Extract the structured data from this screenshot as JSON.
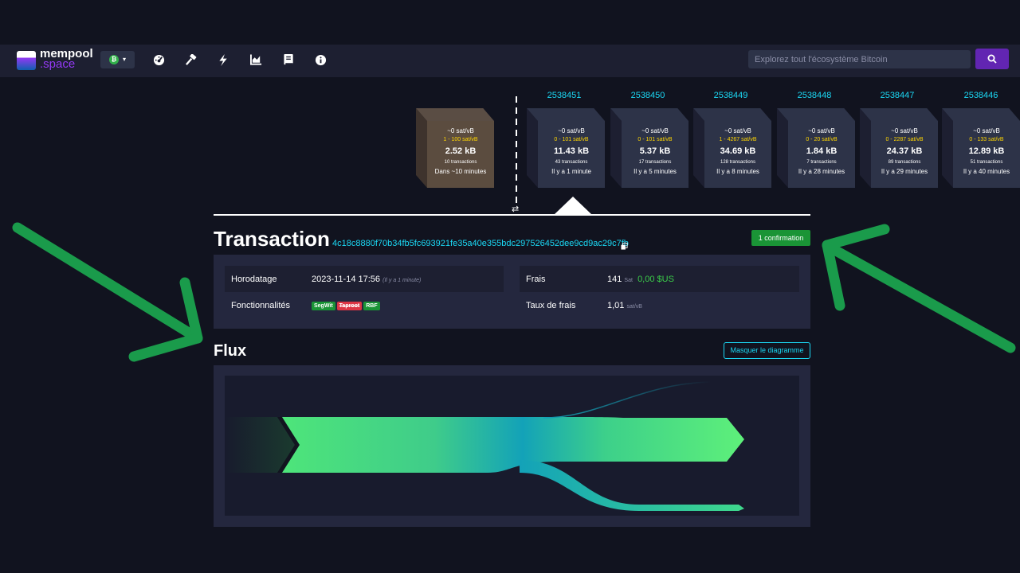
{
  "nav": {
    "logo_top": "mempool",
    "logo_bottom": ".space",
    "network_symbol": "₿",
    "search_placeholder": "Explorez tout l'écosystème Bitcoin",
    "icons": [
      "dashboard-icon",
      "hammer-icon",
      "lightning-icon",
      "chart-icon",
      "book-icon",
      "info-icon"
    ]
  },
  "pending_block": {
    "fee": "~0 sat/vB",
    "range": "1 - 100 sat/vB",
    "size": "2.52 kB",
    "txs": "10 transactions",
    "time": "Dans ~10 minutes"
  },
  "blocks": [
    {
      "height": "2538451",
      "fee": "~0 sat/vB",
      "range": "0 - 101 sat/vB",
      "size": "11.43 kB",
      "txs": "43 transactions",
      "time": "Il y a 1 minute"
    },
    {
      "height": "2538450",
      "fee": "~0 sat/vB",
      "range": "0 - 101 sat/vB",
      "size": "5.37 kB",
      "txs": "17 transactions",
      "time": "Il y a 5 minutes"
    },
    {
      "height": "2538449",
      "fee": "~0 sat/vB",
      "range": "1 - 4267 sat/vB",
      "size": "34.69 kB",
      "txs": "128 transactions",
      "time": "Il y a 8 minutes"
    },
    {
      "height": "2538448",
      "fee": "~0 sat/vB",
      "range": "0 - 20 sat/vB",
      "size": "1.84 kB",
      "txs": "7 transactions",
      "time": "Il y a 28 minutes"
    },
    {
      "height": "2538447",
      "fee": "~0 sat/vB",
      "range": "0 - 2287 sat/vB",
      "size": "24.37 kB",
      "txs": "89 transactions",
      "time": "Il y a 29 minutes"
    },
    {
      "height": "2538446",
      "fee": "~0 sat/vB",
      "range": "0 - 133 sat/vB",
      "size": "12.89 kB",
      "txs": "51 transactions",
      "time": "Il y a 40 minutes"
    }
  ],
  "swap_symbol": "⇄",
  "transaction": {
    "title": "Transaction",
    "txid": "4c18c8880f70b34fb5fc693921fe35a40e355bdc297526452dee9cd9ac29c7fb",
    "confirmations": "1 confirmation",
    "timestamp_label": "Horodatage",
    "timestamp_value": "2023-11-14 17:56",
    "timestamp_relative": "(Il y a 1 minute)",
    "features_label": "Fonctionnalités",
    "features": [
      "SegWit",
      "Taproot",
      "RBF"
    ],
    "fee_label": "Frais",
    "fee_value": "141",
    "fee_unit": "Sat",
    "fee_usd": "0,00 $US",
    "rate_label": "Taux de frais",
    "rate_value": "1,01",
    "rate_unit": "sat/vB"
  },
  "flux": {
    "title": "Flux",
    "hide_button": "Masquer le diagramme"
  },
  "colors": {
    "accent": "#1bd8f4",
    "purple": "#6225b2",
    "green_badge": "#1a9436",
    "annotation_arrow": "#1a9b4b"
  }
}
